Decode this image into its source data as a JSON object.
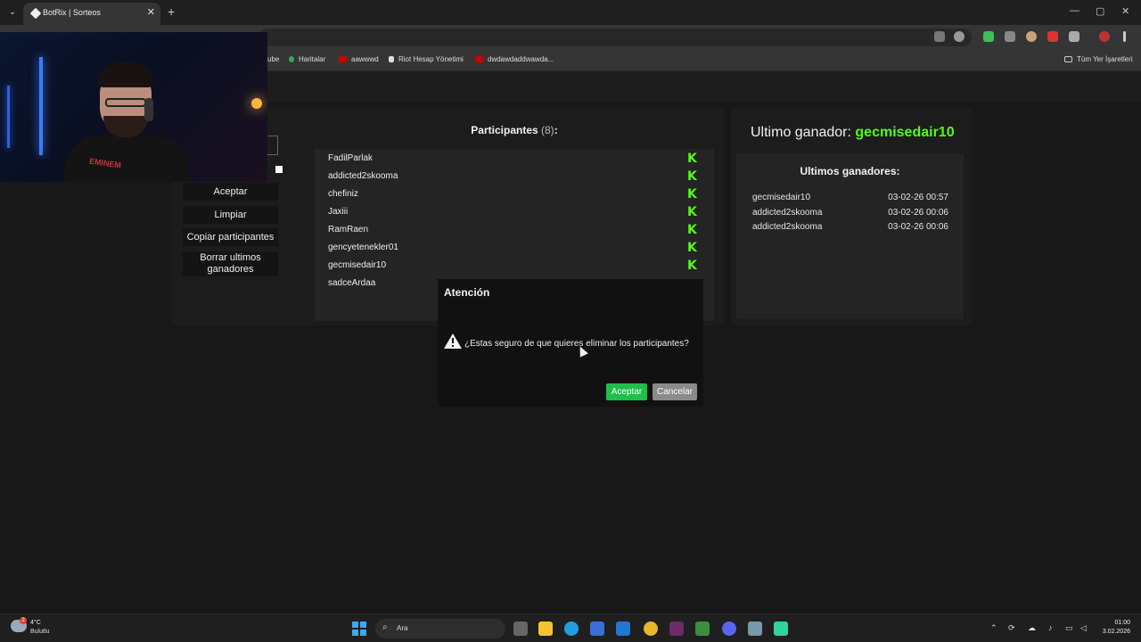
{
  "browser": {
    "tab_title": "BotRix | Sorteos",
    "new_tab_glyph": "+",
    "tab_close_glyph": "✕",
    "window_controls": [
      "—",
      "▢",
      "✕"
    ],
    "bookmarks": [
      {
        "label": "ube",
        "icon": "youtube-icon",
        "color": "#cc0000"
      },
      {
        "label": "Haritalar",
        "icon": "maps-icon",
        "color": "#34a853"
      },
      {
        "label": "aawwwd",
        "icon": "youtube-icon",
        "color": "#cc0000"
      },
      {
        "label": "Riot Hesap Yönetimi",
        "icon": "riot-icon",
        "color": "#dddddd"
      },
      {
        "label": "dwdawdaddwawda...",
        "icon": "youtube-icon",
        "color": "#cc0000"
      }
    ],
    "all_bookmarks_label": "Tüm Yer İşaretleri"
  },
  "left_panel": {
    "buttons": [
      {
        "label": "Aceptar"
      },
      {
        "label": "Limpiar"
      },
      {
        "label": "Copiar participantes"
      },
      {
        "label": "Borrar ultimos ganadores"
      }
    ]
  },
  "participants": {
    "title": "Participantes",
    "count": "(8)",
    "colon": ":",
    "list": [
      "FadilParlak",
      "addicted2skooma",
      "chefiniz",
      "Jaxiii",
      "RamRaen",
      "gencyetenekler01",
      "gecmisedair10",
      "sadceArdaa"
    ],
    "platform_icon": "kick-icon",
    "platform_color": "#53fc18",
    "platform_glyph": "K"
  },
  "winner": {
    "label": "Ultimo ganador:",
    "name": "gecmisedair10",
    "recent_title": "Ultimos ganadores:",
    "recent": [
      {
        "name": "gecmisedair10",
        "date": "03-02-26 00:57"
      },
      {
        "name": "addicted2skooma",
        "date": "03-02-26 00:06"
      },
      {
        "name": "addicted2skooma",
        "date": "03-02-26 00:06"
      }
    ]
  },
  "webcam": {
    "shirt_text": "EMINEM"
  },
  "modal": {
    "title": "Atención",
    "message": "¿Estas seguro de que quieres eliminar los participantes?",
    "ok_label": "Aceptar",
    "cancel_label": "Cancelar",
    "ok_color": "#1fbf4a",
    "cancel_color": "#8a8a8a"
  },
  "taskbar": {
    "weather_temp": "4°C",
    "weather_desc": "Bulutlu",
    "weather_badge": "2",
    "search_placeholder": "Ara",
    "time": "01:00",
    "date": "3.02.2026"
  }
}
